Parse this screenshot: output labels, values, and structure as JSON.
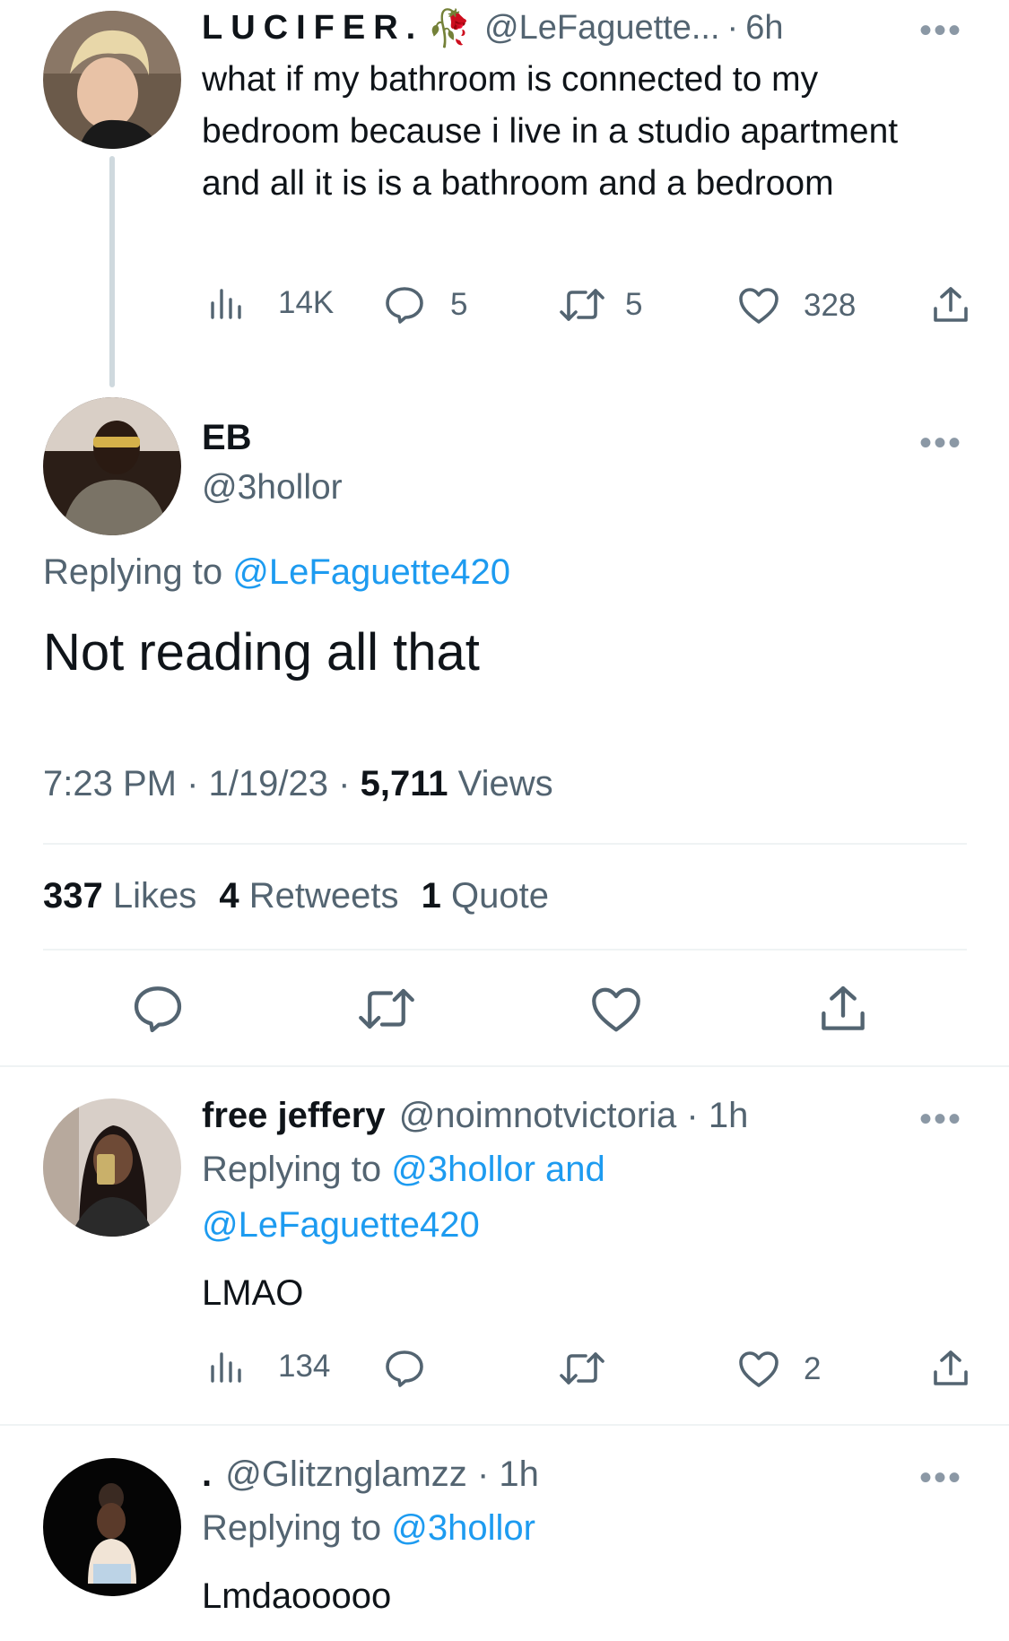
{
  "tweet1": {
    "display_name": "LUCIFER.",
    "name_emoji": "🥀",
    "handle": "@LeFaguette...",
    "sep": "·",
    "time": "6h",
    "text": "what if my bathroom is connected to my bedroom because i live in a studio apartment and all it is is a bathroom and a bedroom",
    "views": "14K",
    "replies": "5",
    "retweets": "5",
    "likes": "328"
  },
  "main_tweet": {
    "display_name": "EB",
    "handle": "@3hollor",
    "replying_prefix": "Replying to",
    "replying_to": "@LeFaguette420",
    "text": "Not reading all that",
    "time": "7:23 PM",
    "sep": "·",
    "date": "1/19/23",
    "views_count": "5,711",
    "views_label": "Views",
    "likes_count": "337",
    "likes_label": "Likes",
    "retweets_count": "4",
    "retweets_label": "Retweets",
    "quotes_count": "1",
    "quotes_label": "Quote"
  },
  "reply1": {
    "display_name": "free jeffery",
    "handle": "@noimnotvictoria",
    "sep": "·",
    "time": "1h",
    "replying_prefix": "Replying to",
    "replying_to_1": "@3hollor and",
    "replying_to_2": "@LeFaguette420",
    "text": "LMAO",
    "views": "134",
    "likes": "2"
  },
  "reply2": {
    "display_name": ".",
    "handle": "@Glitznglamzz",
    "sep": "·",
    "time": "1h",
    "replying_prefix": "Replying to",
    "replying_to": "@3hollor",
    "text": "Lmdaooooo"
  },
  "more_glyph": "•••",
  "colors": {
    "accent": "#1d9bf0",
    "secondary": "#536471",
    "text": "#0f1419",
    "divider": "#eff3f4"
  },
  "icons": [
    "views-icon",
    "reply-icon",
    "retweet-icon",
    "like-icon",
    "share-icon",
    "more-icon"
  ]
}
